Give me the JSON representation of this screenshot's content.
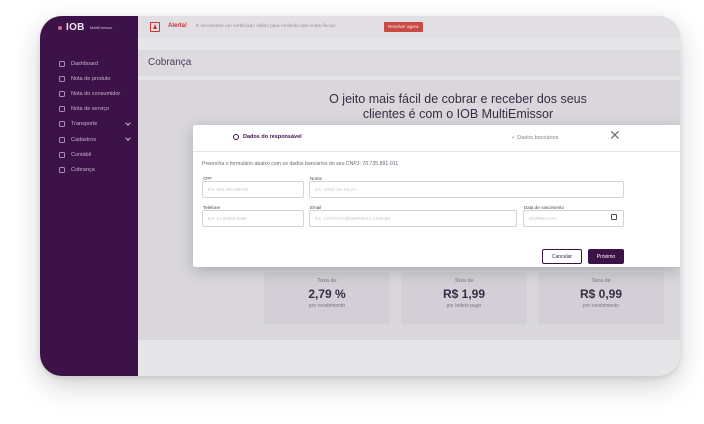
{
  "brand": {
    "logo": "IOB",
    "logo_sub": "MultiEmissor"
  },
  "sidebar": {
    "items": [
      {
        "label": "Dashboard",
        "icon": "dashboard-icon"
      },
      {
        "label": "Nota de produto",
        "icon": "box-icon"
      },
      {
        "label": "Nota do consumidor",
        "icon": "receipt-icon"
      },
      {
        "label": "Nota de serviço",
        "icon": "tool-icon"
      },
      {
        "label": "Transporte",
        "icon": "truck-icon",
        "expandable": true
      },
      {
        "label": "Cadastros",
        "icon": "users-icon",
        "expandable": true
      },
      {
        "label": "Contábil",
        "icon": "calculator-icon"
      },
      {
        "label": "Cobrança",
        "icon": "wallet-icon"
      }
    ]
  },
  "alert": {
    "title": "Alerta!",
    "text": "É necessário um certificado válido para emissão das notas fiscais.",
    "button": "Resolver agora"
  },
  "page": {
    "title": "Cobrança",
    "hero_line1": "O jeito mais fácil de cobrar e receber dos seus",
    "hero_line2": "clientes é com o IOB MultiEmissor"
  },
  "cards": [
    {
      "label": "Taxa de",
      "value": "2,79 %",
      "sub": "por recebimento"
    },
    {
      "label": "Taxa de",
      "value": "R$ 1,99",
      "sub": "por boleto pago"
    },
    {
      "label": "Taxa de",
      "value": "R$ 0,99",
      "sub": "por recebimento"
    }
  ],
  "modal": {
    "step1": "Dados do responsável",
    "step2": "✓ Dados bancários",
    "close": "✕",
    "intro": "Preencha o formulário abaixo com os dados bancários do seu CNPJ: 70.735.891-911",
    "fields": {
      "cpf": {
        "label": "CPF",
        "placeholder": "EX: 000.000.000-00"
      },
      "nome": {
        "label": "Nome",
        "placeholder": "EX: JOSÉ DA SILVA"
      },
      "telefone": {
        "label": "Telefone",
        "placeholder": "EX: 12 94556-5555"
      },
      "email": {
        "label": "Email",
        "placeholder": "EX: CONTATO@EMPRESA.COM.BR"
      },
      "nascimento": {
        "label": "Data de nascimento",
        "placeholder": "DD/MM/AAAA"
      }
    },
    "cancel": "Cancelar",
    "next": "Próximo"
  },
  "colors": {
    "primary": "#3d1248",
    "alert": "#c94a45"
  }
}
